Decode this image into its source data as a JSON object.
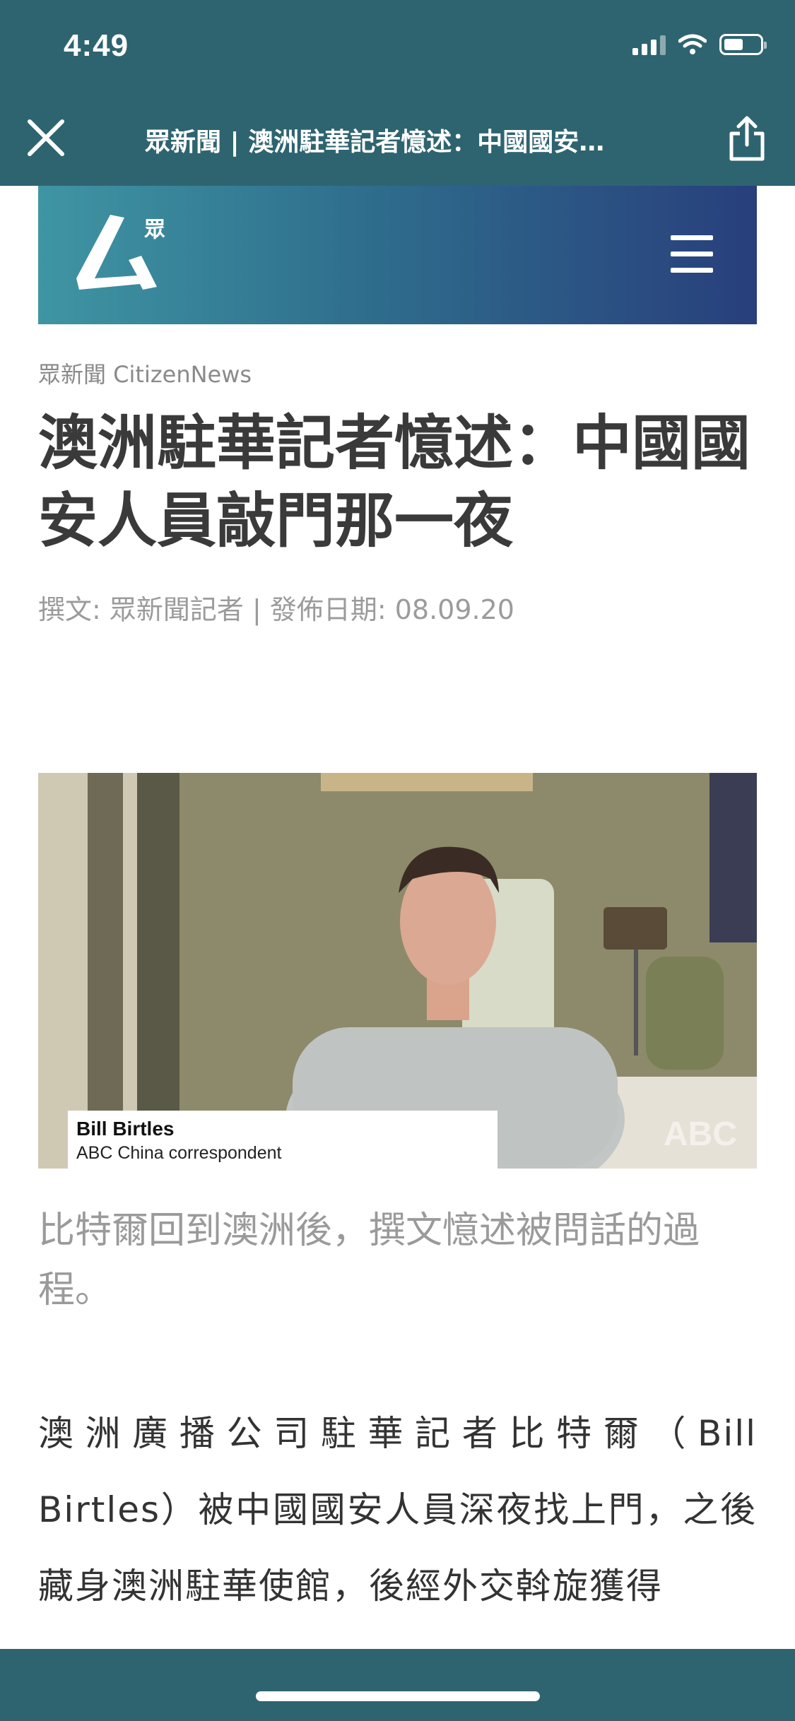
{
  "status_bar": {
    "time": "4:49"
  },
  "nav": {
    "title": "眾新聞 | 澳洲駐華記者憶述：中國國安…",
    "close_icon": "close-icon",
    "share_icon": "share-icon"
  },
  "site_header": {
    "logo_text": "眾"
  },
  "article": {
    "source": "眾新聞 CitizenNews",
    "headline": "澳洲駐華記者憶述：中國國安人員敲門那一夜",
    "byline": "撰文: 眾新聞記者 | 發佈日期: 08.09.20",
    "photo": {
      "name": "Bill Birtles",
      "role": "ABC China correspondent",
      "watermark": "ABC"
    },
    "caption": "比特爾回到澳洲後，撰文憶述被問話的過程。",
    "body": "澳洲廣播公司駐華記者比特爾（Bill Birtles）被中國國安人員深夜找上門，之後藏身澳洲駐華使館，後經外交斡旋獲得"
  },
  "colors": {
    "bar": "#2e6470",
    "banner_start": "#3f95a3",
    "banner_end": "#283f7c",
    "headline": "#3a3a3a",
    "muted": "#9b9b9b"
  }
}
